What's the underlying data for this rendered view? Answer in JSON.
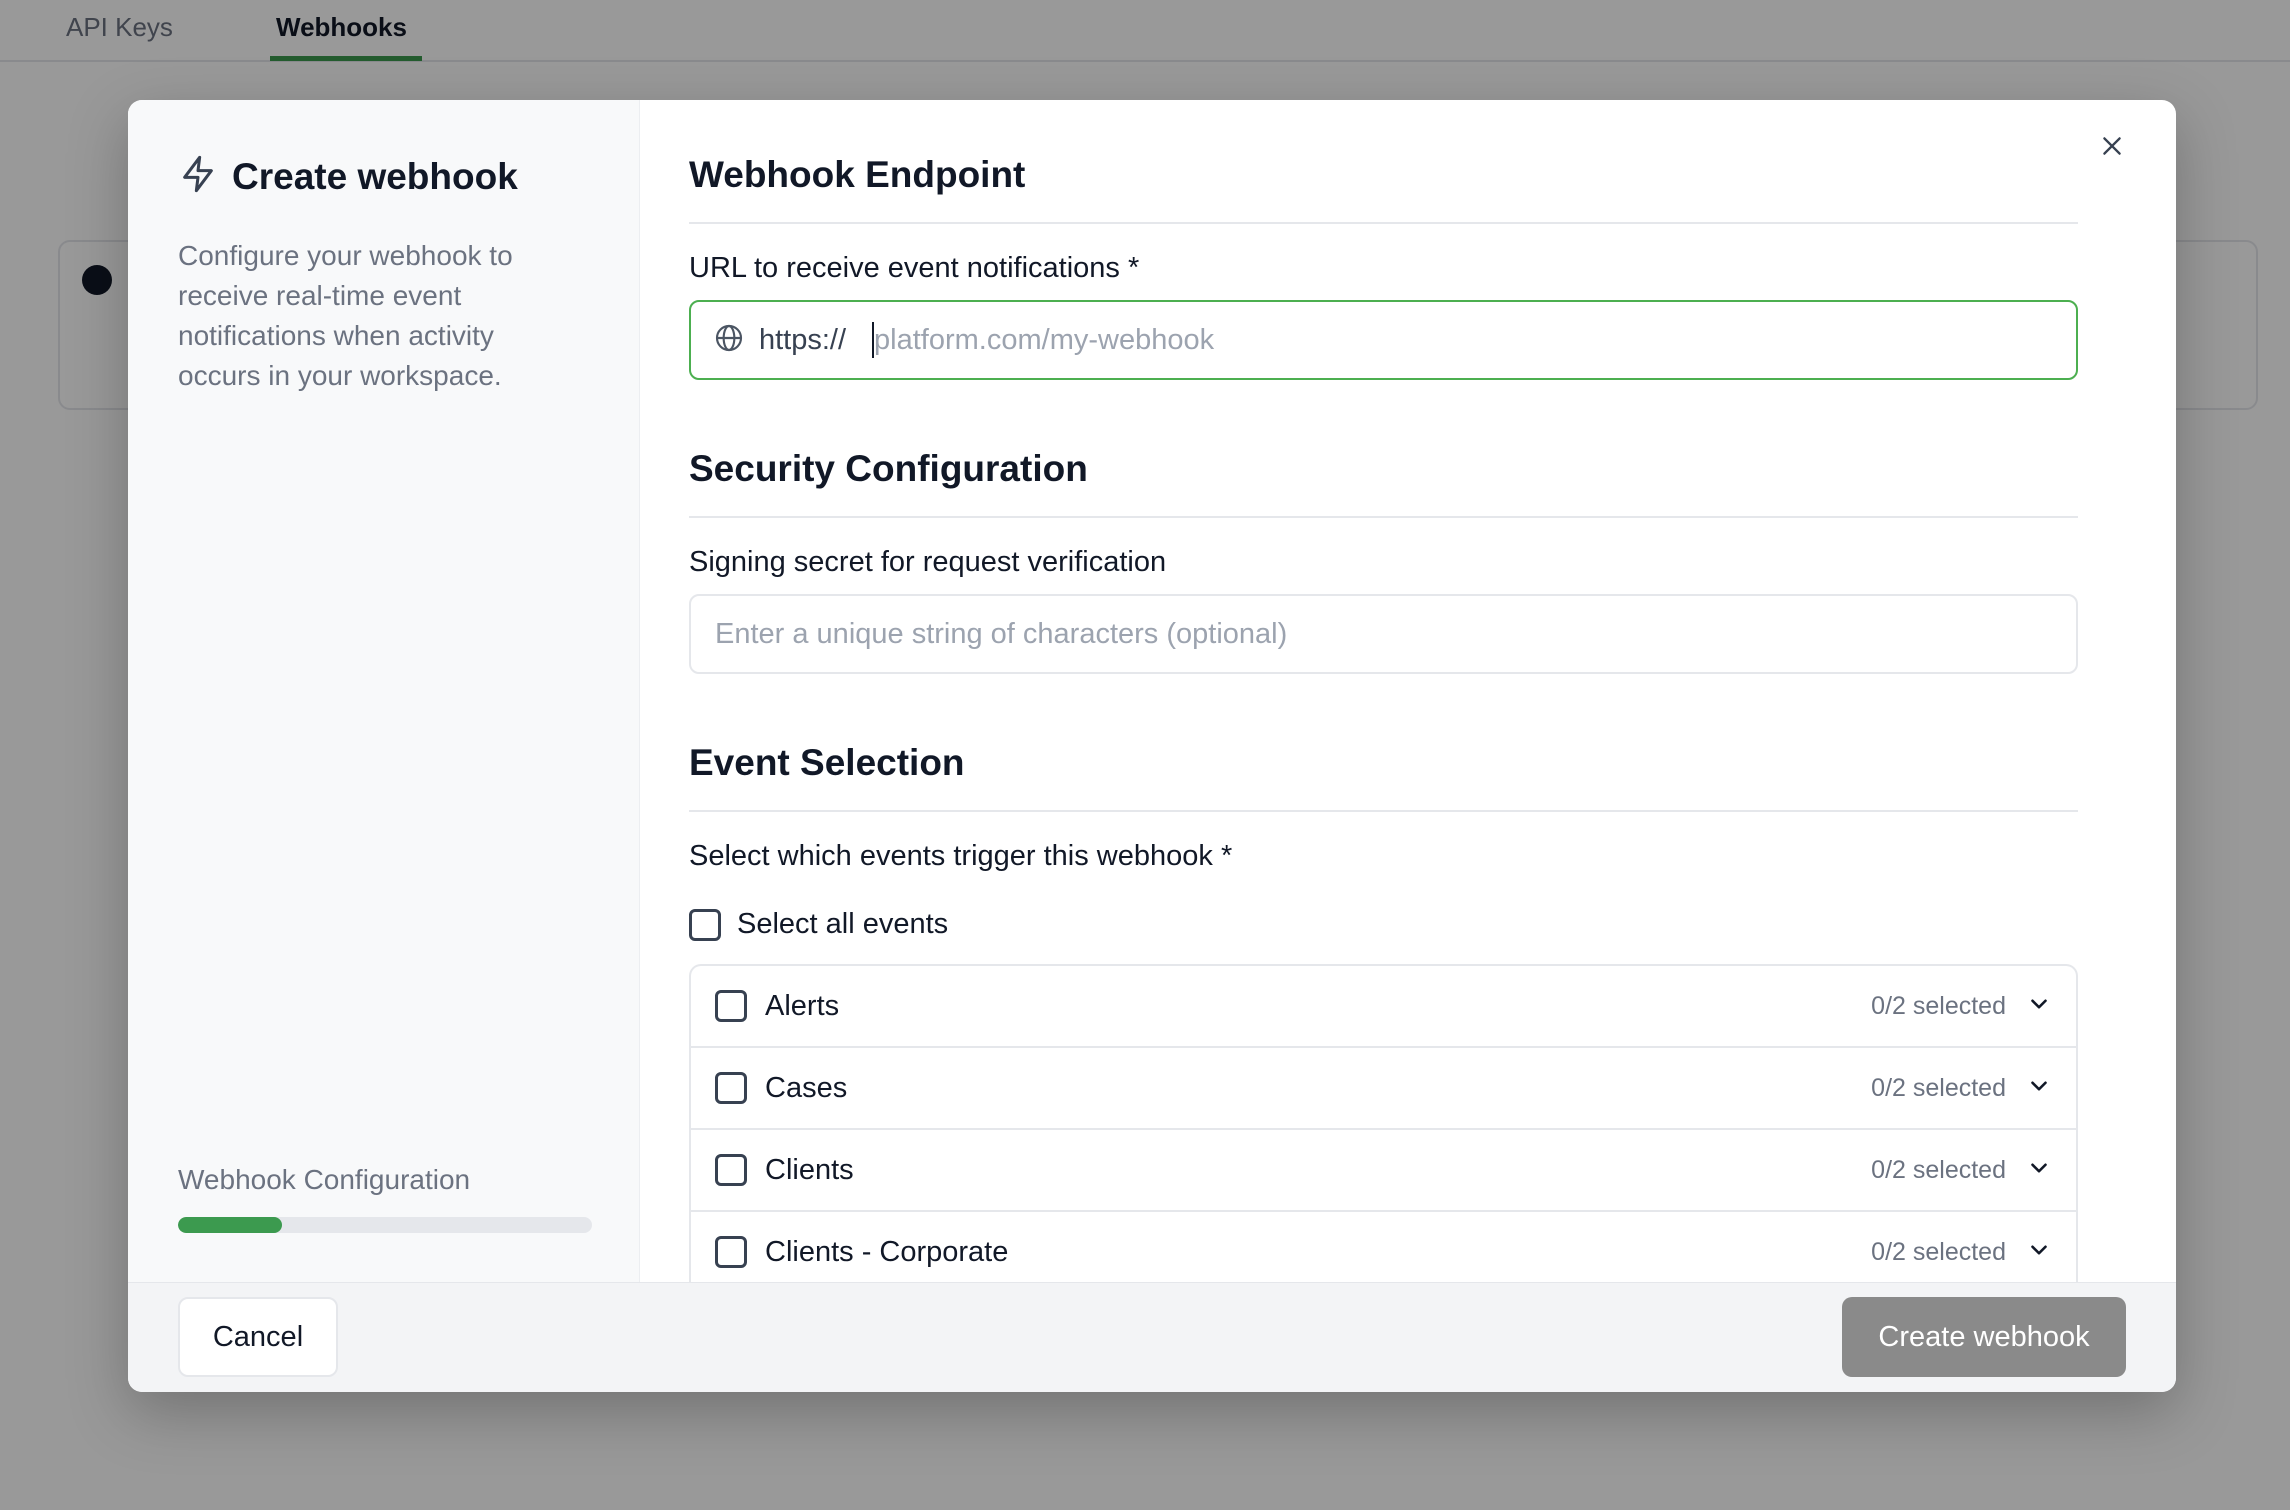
{
  "background": {
    "tabs": [
      "API Keys",
      "Webhooks"
    ],
    "active_tab": "Webhooks",
    "accent": "#3c9a4f"
  },
  "modal": {
    "title": "Create webhook",
    "title_icon": "lightning-bolt-icon",
    "description": "Configure your webhook to receive real-time event notifications when activity occurs in your workspace.",
    "progress": {
      "label": "Webhook Configuration",
      "value_percent": 25
    },
    "close_icon": "close-icon",
    "sections": {
      "endpoint": {
        "title": "Webhook Endpoint",
        "url_label": "URL to receive event notifications *",
        "url_prefix": "https://",
        "url_placeholder": "platform.com/my-webhook",
        "url_icon": "globe-icon"
      },
      "security": {
        "title": "Security Configuration",
        "secret_label": "Signing secret for request verification",
        "secret_placeholder": "Enter a unique string of characters (optional)"
      },
      "events": {
        "title": "Event Selection",
        "label": "Select which events trigger this webhook *",
        "select_all_label": "Select all events",
        "items": [
          {
            "name": "Alerts",
            "count": "0/2 selected"
          },
          {
            "name": "Cases",
            "count": "0/2 selected"
          },
          {
            "name": "Clients",
            "count": "0/2 selected"
          },
          {
            "name": "Clients - Corporate",
            "count": "0/2 selected"
          }
        ]
      }
    },
    "footer": {
      "cancel_label": "Cancel",
      "create_label": "Create webhook"
    },
    "colors": {
      "focus_border": "#4caf50",
      "progress_fill": "#3c9a4f",
      "create_button_disabled": "#8a8a8a"
    }
  }
}
